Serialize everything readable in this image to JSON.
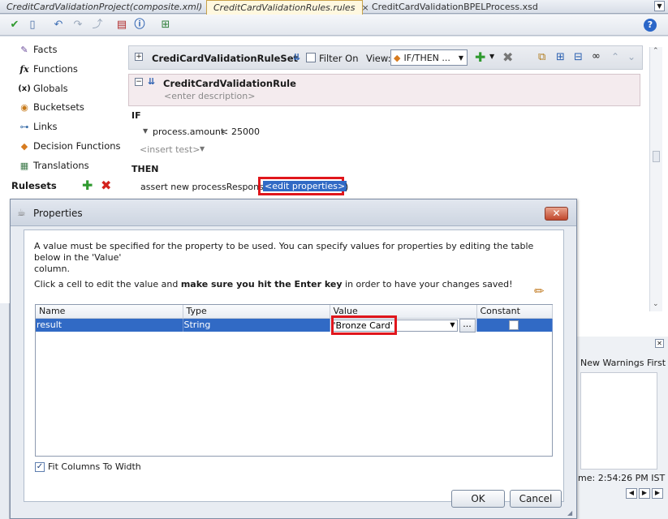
{
  "tabs": [
    {
      "label": "CreditCardValidationProject(composite.xml)",
      "close": "×"
    },
    {
      "label": "CreditCardValidationRules.rules",
      "close": "×"
    },
    {
      "label": "CreditCardValidationBPELProcess.xsd",
      "close": ""
    }
  ],
  "toolbar": {
    "help": "?"
  },
  "sidebar": {
    "items": [
      {
        "label": "Facts",
        "icon": "facts-icon"
      },
      {
        "label": "Functions",
        "icon": "functions-icon"
      },
      {
        "label": "Globals",
        "icon": "globals-icon"
      },
      {
        "label": "Bucketsets",
        "icon": "bucketsets-icon"
      },
      {
        "label": "Links",
        "icon": "links-icon"
      },
      {
        "label": "Decision Functions",
        "icon": "decision-functions-icon"
      },
      {
        "label": "Translations",
        "icon": "translations-icon"
      }
    ],
    "rulesets_label": "Rulesets",
    "func_glyph": "fx",
    "globals_glyph": "(x)"
  },
  "ruleset": {
    "name": "CrediCardValidationRuleSet",
    "filter_label": "Filter On",
    "view_label": "View:",
    "view_value": "IF/THEN ..."
  },
  "rule": {
    "name": "CreditCardValidationRule",
    "description_placeholder": "<enter description>",
    "if_label": "IF",
    "condition_left": "process.amount",
    "condition_op": "<",
    "condition_right": "25000",
    "insert_test": "<insert test>",
    "then_label": "THEN",
    "action_prefix": "assert new processResponse (",
    "action_props": "<edit properties>",
    "action_suffix": ")"
  },
  "right_panel": {
    "warnings_label": "New Warnings First",
    "time_label": "ime: 2:54:26 PM IST"
  },
  "dialog": {
    "title": "Properties",
    "close_glyph": "✕",
    "info_line1": "A value must be specified for the property to be used. You can specify values for properties by editing the table below in the 'Value'",
    "info_line1b": "column.",
    "info_line2_pre": "Click a cell to edit the value and ",
    "info_line2_bold": "make sure you hit the Enter key",
    "info_line2_post": " in order to have your changes saved!",
    "columns": [
      "Name",
      "Type",
      "Value",
      "Constant"
    ],
    "rows": [
      {
        "name": "result",
        "type": "String",
        "value": "'Bronze Card'",
        "constant": false
      }
    ],
    "ellipsis": "...",
    "fit_columns_label": "Fit Columns To Width",
    "fit_columns_checked": true,
    "ok_label": "OK",
    "cancel_label": "Cancel"
  },
  "colors": {
    "selection": "#316ac5",
    "highlight_box": "#e0161c",
    "active_tab": "#fff8df"
  }
}
